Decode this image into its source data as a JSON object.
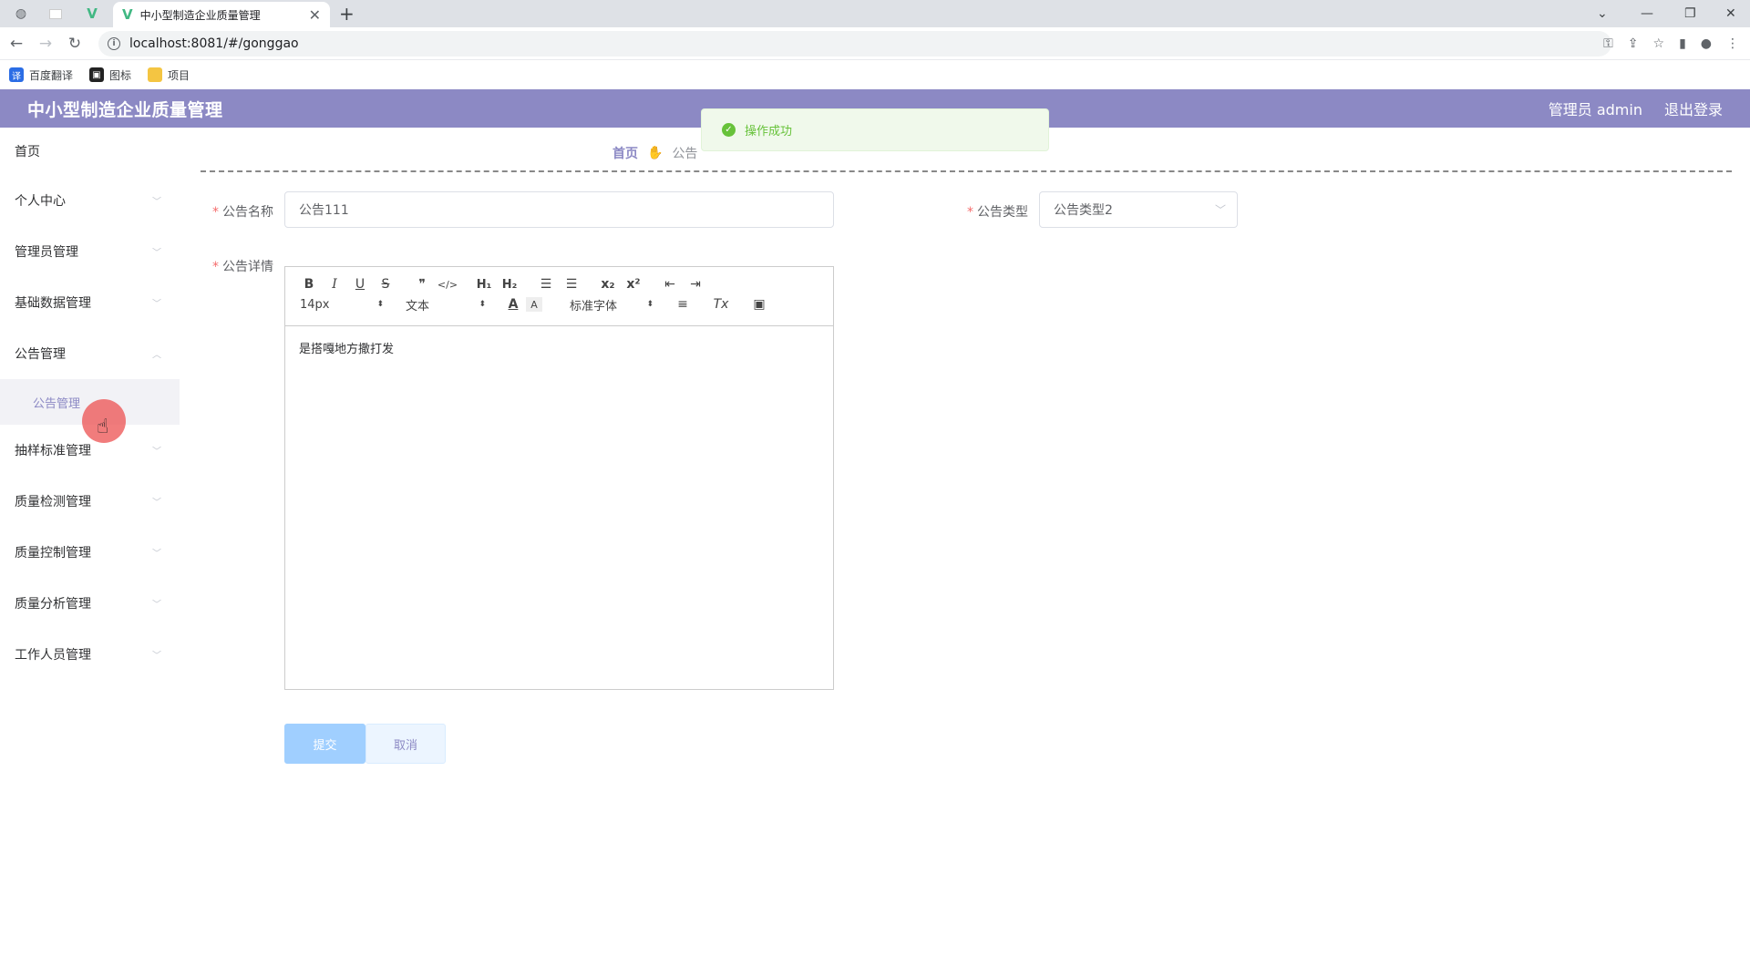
{
  "browser": {
    "tab_title": "中小型制造企业质量管理",
    "url": "localhost:8081/#/gonggao",
    "bookmarks": [
      {
        "label": "百度翻译"
      },
      {
        "label": "图标"
      },
      {
        "label": "项目"
      }
    ]
  },
  "header": {
    "title": "中小型制造企业质量管理",
    "user": "管理员 admin",
    "logout": "退出登录",
    "color": "#8c89c4"
  },
  "sidebar": {
    "items": [
      {
        "label": "首页"
      },
      {
        "label": "个人中心"
      },
      {
        "label": "管理员管理"
      },
      {
        "label": "基础数据管理"
      },
      {
        "label": "公告管理"
      },
      {
        "label": "公告管理"
      },
      {
        "label": "抽样标准管理"
      },
      {
        "label": "质量检测管理"
      },
      {
        "label": "质量控制管理"
      },
      {
        "label": "质量分析管理"
      },
      {
        "label": "工作人员管理"
      }
    ]
  },
  "breadcrumb": {
    "home": "首页",
    "current": "公告"
  },
  "form": {
    "name_label": "公告名称",
    "name_value": "公告111",
    "type_label": "公告类型",
    "type_value": "公告类型2",
    "detail_label": "公告详情",
    "required_mark": "*"
  },
  "editor": {
    "font_size": "14px",
    "paragraph": "文本",
    "font_family": "标准字体",
    "content": "是搭嘎地方撒打发",
    "tools": {
      "bold": "B",
      "italic": "I",
      "underline": "U",
      "strike": "S",
      "quote": "❞",
      "code": "</>",
      "h1": "H₁",
      "h2": "H₂",
      "ol": "☰",
      "ul": "☰",
      "sub": "x₂",
      "sup": "x²",
      "indent_dec": "⇤",
      "indent_inc": "⇥",
      "color": "A",
      "background": "A",
      "align": "≡",
      "clean": "Tx",
      "image": "▣"
    }
  },
  "buttons": {
    "submit": "提交",
    "cancel": "取消"
  },
  "toast": {
    "message": "操作成功"
  }
}
